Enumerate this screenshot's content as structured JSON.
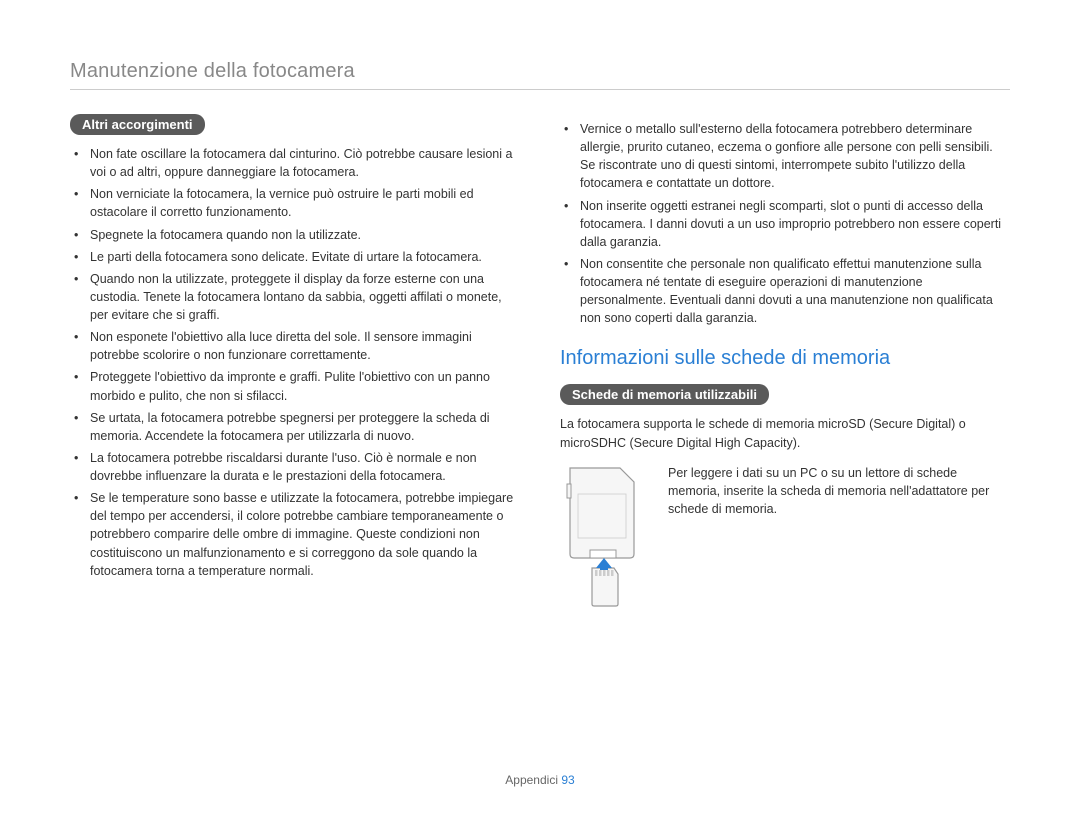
{
  "page_title": "Manutenzione della fotocamera",
  "left": {
    "pill": "Altri accorgimenti",
    "items": [
      "Non fate oscillare la fotocamera dal cinturino. Ciò potrebbe causare lesioni a voi o ad altri, oppure danneggiare la fotocamera.",
      "Non verniciate la fotocamera, la vernice può ostruire le parti mobili ed ostacolare il corretto funzionamento.",
      "Spegnete la fotocamera quando non la utilizzate.",
      "Le parti della fotocamera sono delicate. Evitate di urtare la fotocamera.",
      "Quando non la utilizzate, proteggete il display da forze esterne con una custodia. Tenete la fotocamera lontano da sabbia, oggetti affilati o monete, per evitare che si graffi.",
      "Non esponete l'obiettivo alla luce diretta del sole. Il sensore immagini potrebbe scolorire o non funzionare correttamente.",
      "Proteggete l'obiettivo da impronte e graffi. Pulite l'obiettivo con un panno morbido e pulito, che non si sfilacci.",
      "Se urtata, la fotocamera potrebbe spegnersi  per proteggere la scheda di memoria. Accendete la fotocamera per utilizzarla di nuovo.",
      "La fotocamera potrebbe riscaldarsi durante l'uso. Ciò è normale e non dovrebbe influenzare la durata e le prestazioni della fotocamera.",
      "Se le temperature sono basse e utilizzate la fotocamera, potrebbe impiegare del tempo per accendersi, il colore potrebbe cambiare temporaneamente o potrebbero comparire delle ombre di immagine. Queste condizioni non costituiscono un malfunzionamento e si correggono da sole quando la fotocamera torna a temperature normali."
    ]
  },
  "right": {
    "cont_items": [
      "Vernice o metallo sull'esterno della fotocamera potrebbero determinare allergie, prurito cutaneo, eczema o gonfiore alle persone con pelli sensibili. Se riscontrate uno di questi sintomi, interrompete subito l'utilizzo della fotocamera e contattate un dottore.",
      "Non inserite oggetti estranei negli scomparti, slot o punti di accesso della fotocamera. I danni dovuti a un uso improprio potrebbero non essere coperti dalla garanzia.",
      "Non consentite che personale non qualificato effettui manutenzione sulla fotocamera né tentate di eseguire operazioni di manutenzione personalmente. Eventuali danni dovuti a una manutenzione non qualificata non sono coperti dalla garanzia."
    ],
    "heading": "Informazioni sulle schede di memoria",
    "pill": "Schede di memoria utilizzabili",
    "para": "La fotocamera supporta le schede di memoria microSD (Secure Digital) o microSDHC (Secure Digital High Capacity).",
    "sd_text": "Per leggere i dati su un PC o su un lettore di schede memoria, inserite la scheda di memoria nell'adattatore per schede di memoria."
  },
  "footer": {
    "label": "Appendici",
    "page": "93"
  }
}
